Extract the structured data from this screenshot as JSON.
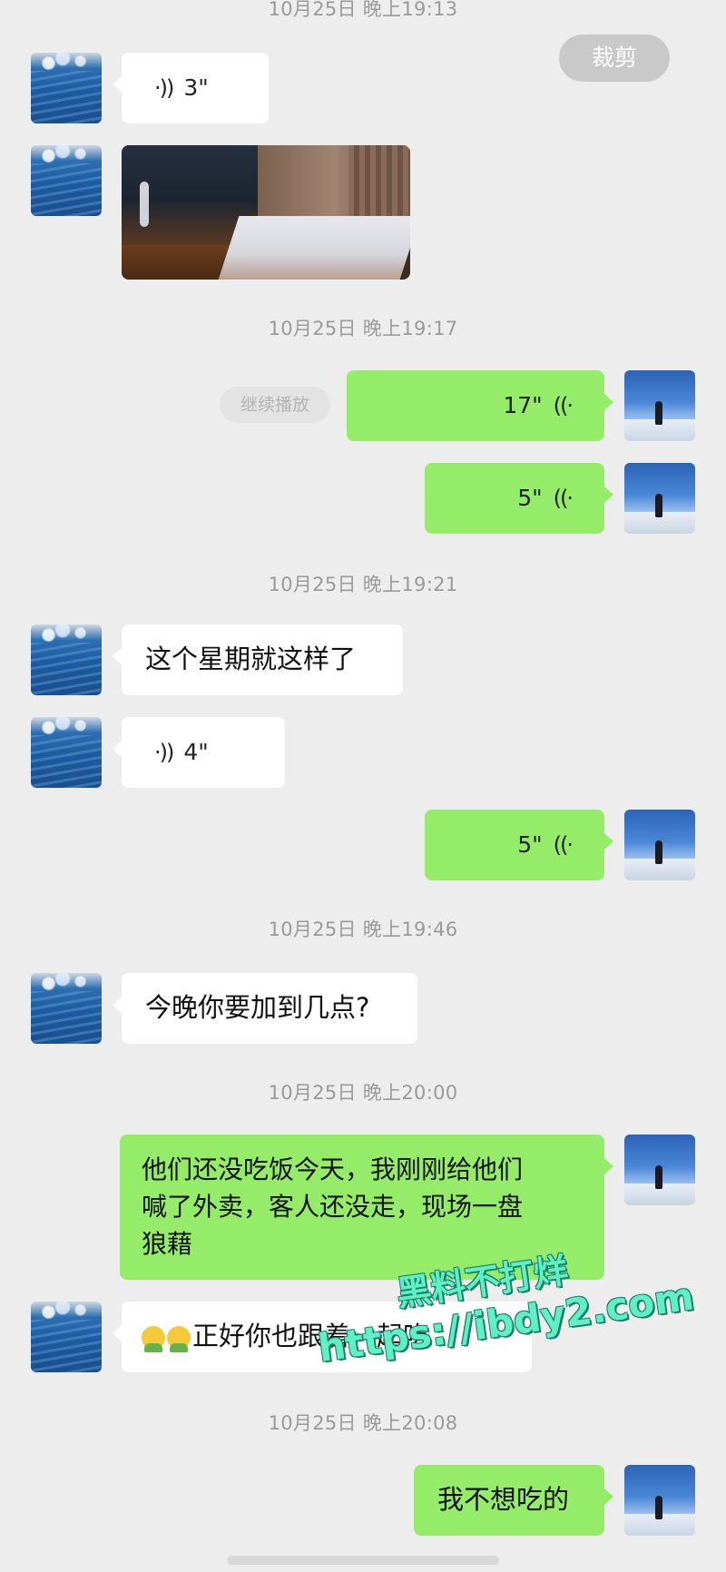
{
  "header": {
    "crop_button_label": "裁剪"
  },
  "timestamps": [
    "10月25日 晚上19:13",
    "10月25日 晚上19:17",
    "10月25日 晚上19:21",
    "10月25日 晚上19:46",
    "10月25日 晚上20:00",
    "10月25日 晚上20:08"
  ],
  "messages": {
    "m1_voice_duration": "3\"",
    "m3_voice_duration": "17\"",
    "m3_continue_label": "继续播放",
    "m4_voice_duration": "5\"",
    "m5_text": "这个星期就这样了",
    "m6_voice_duration": "4\"",
    "m7_voice_duration": "5\"",
    "m8_text": "今晚你要加到几点?",
    "m9_text_line1": "他们还没吃饭今天，我刚刚给他们",
    "m9_text_line2": "喊了外卖，客人还没走，现场一盘",
    "m9_text_line3": "狼藉",
    "m10_text": "正好你也跟着一起吃",
    "m11_text": "我不想吃的"
  },
  "icons": {
    "voice_in": "voice-wave-icon",
    "voice_out": "voice-wave-icon",
    "emoji": "person-emoji-icon"
  },
  "colors": {
    "background": "#ededed",
    "incoming_bubble": "#ffffff",
    "outgoing_bubble": "#95ec69",
    "timestamp_text": "#9a9a9a",
    "watermark": "#5ff0c6"
  },
  "watermark": {
    "line1": "黑料不打烊",
    "line2": "https://ibdy2.com"
  }
}
